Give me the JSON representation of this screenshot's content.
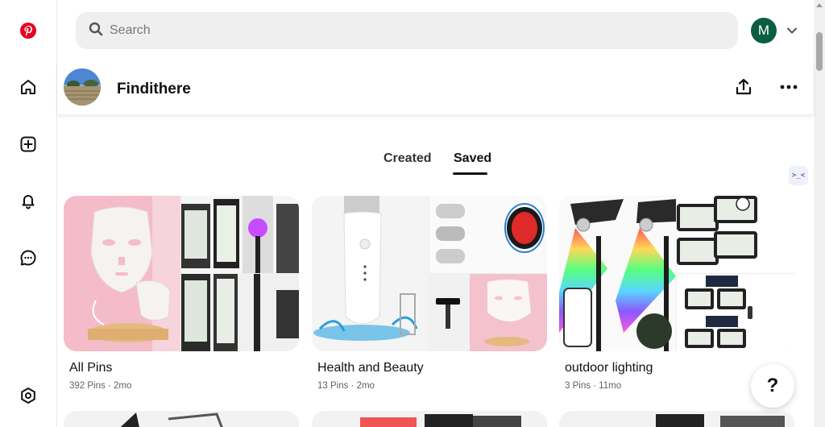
{
  "search": {
    "placeholder": "Search"
  },
  "user": {
    "initial": "M",
    "color": "#0b5e43"
  },
  "nav": {
    "items": [
      {
        "name": "pinterest-logo-icon"
      },
      {
        "name": "home-icon"
      },
      {
        "name": "create-icon"
      },
      {
        "name": "notifications-icon"
      },
      {
        "name": "messages-icon"
      },
      {
        "name": "settings-icon"
      }
    ],
    "brand_color": "#e60023"
  },
  "board_header": {
    "title": "Findithere"
  },
  "tabs": {
    "created": "Created",
    "saved": "Saved"
  },
  "side_toggle": {
    "label": ">_<"
  },
  "boards": [
    {
      "name": "All Pins",
      "meta": "392 Pins · 2mo"
    },
    {
      "name": "Health and Beauty",
      "meta": "13 Pins · 2mo"
    },
    {
      "name": "outdoor lighting",
      "meta": "3 Pins · 11mo"
    }
  ],
  "help": {
    "label": "?"
  }
}
